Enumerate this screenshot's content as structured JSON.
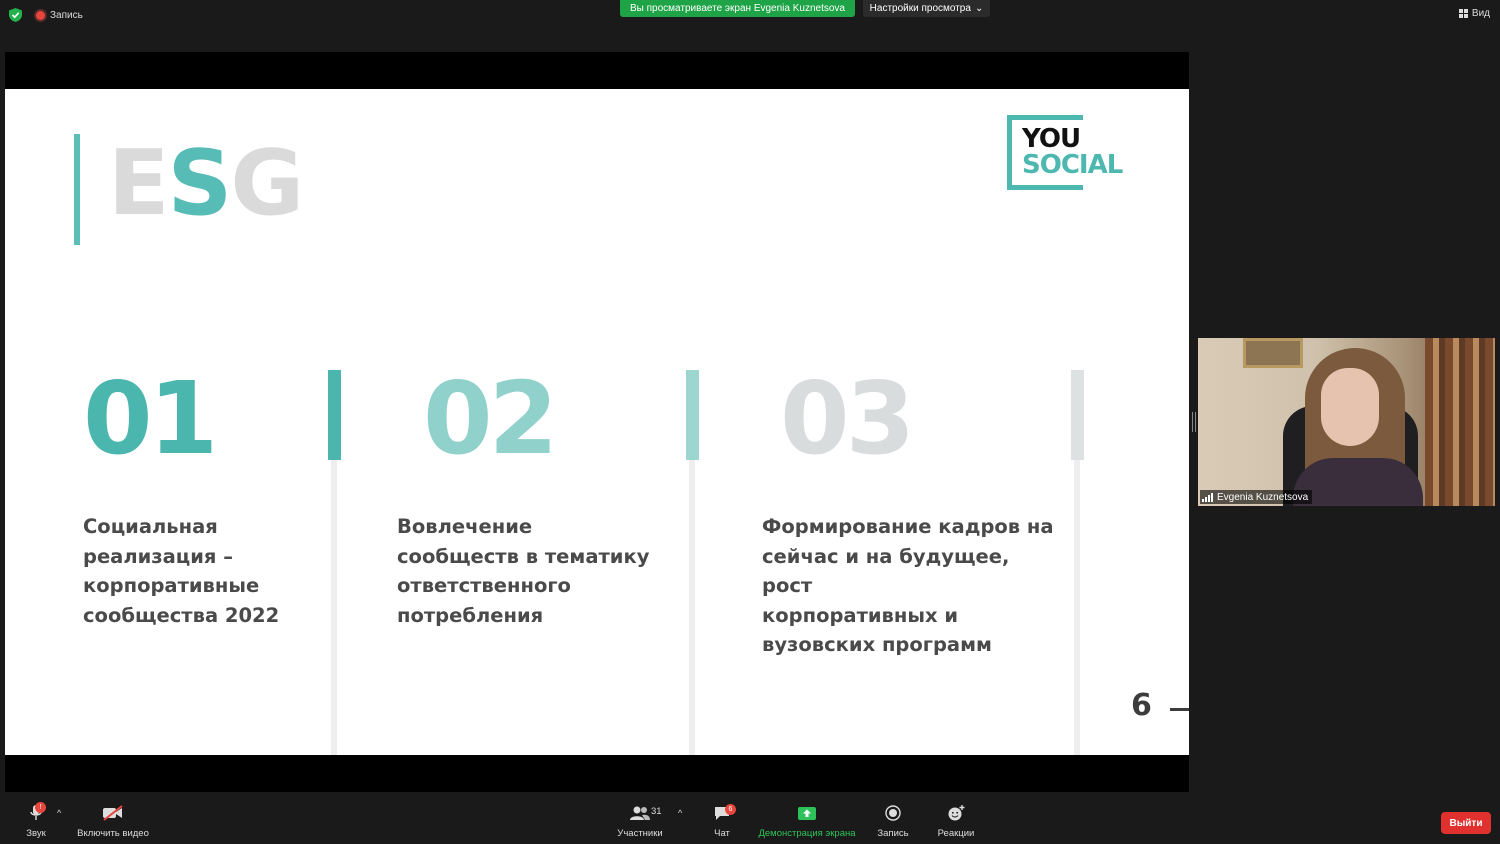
{
  "topbar": {
    "record_label": "Запись",
    "viewing_text": "Вы просматриваете экран Evgenia Kuznetsova",
    "view_settings": "Настройки просмотра",
    "view_label": "Вид"
  },
  "slide": {
    "title_parts": [
      "E",
      "S",
      "G"
    ],
    "logo_line1": "YOU",
    "logo_line2": "SOCIAL",
    "columns": [
      {
        "number": "01",
        "text": "Социальная\nреализация –\nкорпоративные\nсообщества 2022"
      },
      {
        "number": "02",
        "text": "Вовлечение\nсообществ в тематику\nответственного\nпотребления"
      },
      {
        "number": "03",
        "text": "Формирование кадров на\nсейчас и на будущее, рост\nкорпоративных и\nвузовских программ"
      }
    ],
    "page_number": "6",
    "colors": {
      "teal": "#4bb6ae",
      "teal_light": "#90d1cc",
      "grey": "#d8dcdd"
    }
  },
  "participant": {
    "name": "Evgenia Kuznetsova"
  },
  "toolbar": {
    "audio_label": "Звук",
    "video_label": "Включить видео",
    "participants_label": "Участники",
    "participants_count": "31",
    "chat_label": "Чат",
    "chat_badge": "6",
    "share_label": "Демонстрация экрана",
    "record_label": "Запись",
    "reactions_label": "Реакции",
    "leave_label": "Выйти",
    "audio_badge": "!"
  }
}
